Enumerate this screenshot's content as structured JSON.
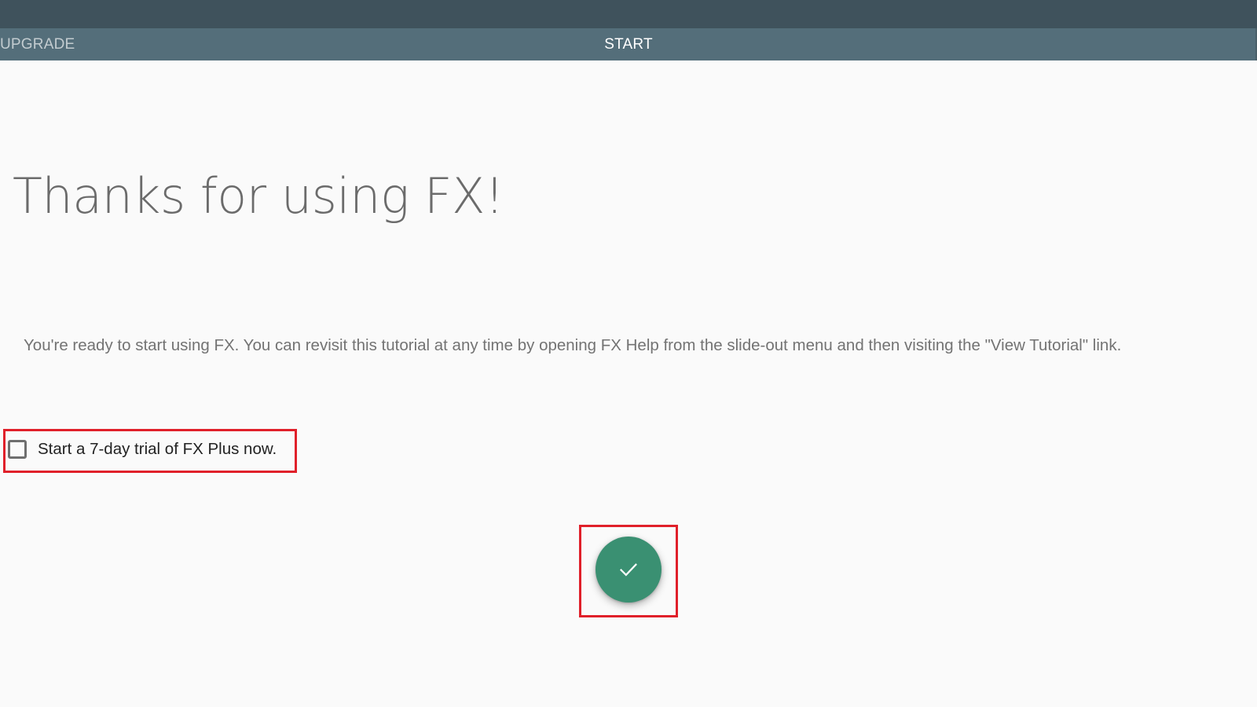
{
  "tabs": {
    "left_label": "UPGRADE",
    "center_label": "START"
  },
  "main": {
    "heading": "Thanks for using FX!",
    "paragraph": "You're ready to start using FX. You can revisit this tutorial at any time by opening FX Help from the slide-out menu and then visiting the \"View Tutorial\" link.",
    "trial_checkbox_label": "Start a 7-day trial of FX Plus now.",
    "trial_checked": false
  },
  "fab": {
    "icon": "check-icon",
    "color": "#3a9072"
  },
  "colors": {
    "status_bar": "#3f525c",
    "tab_bar": "#546e7a",
    "highlight": "#e0202a"
  }
}
